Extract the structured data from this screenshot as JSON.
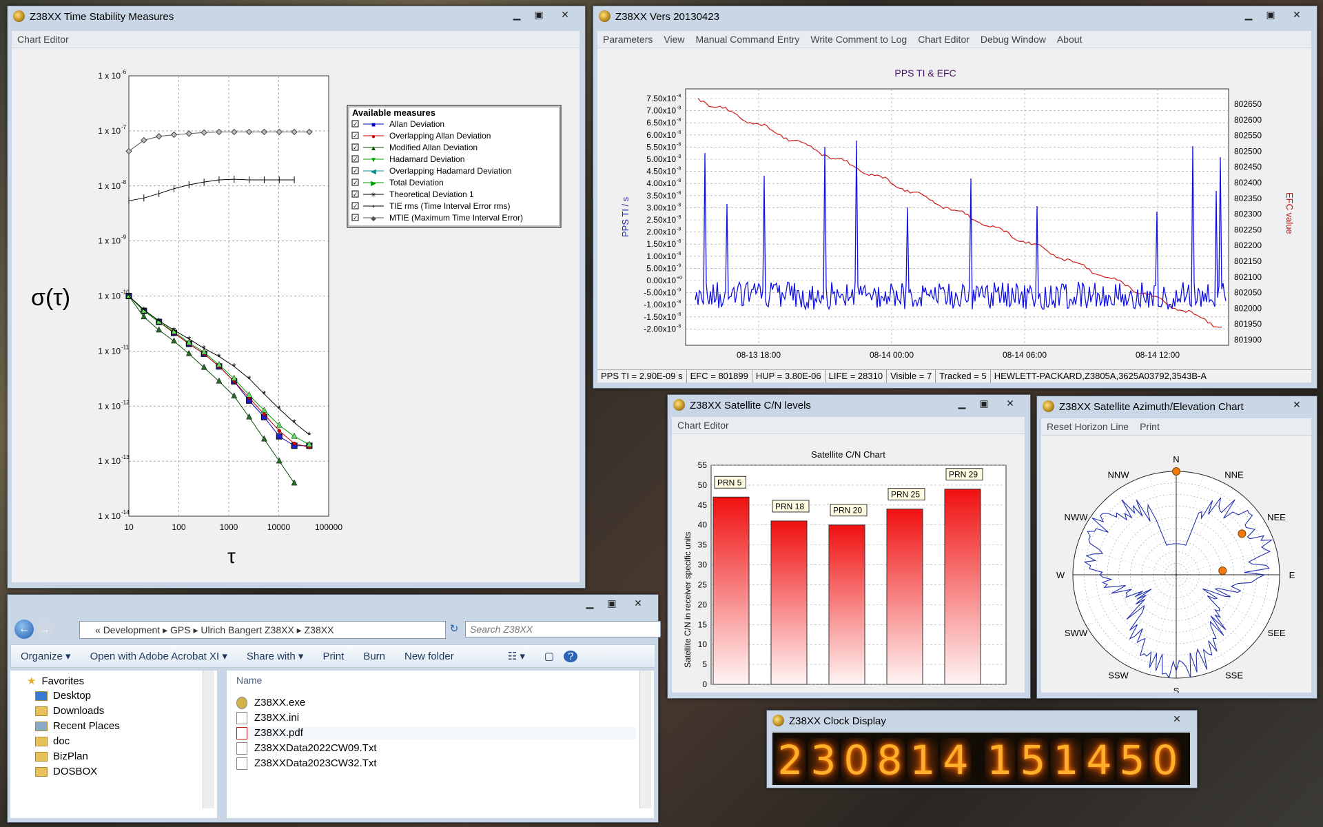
{
  "stability": {
    "title": "Z38XX Time Stability Measures",
    "chart_editor": "Chart Editor",
    "y_label": "σ(τ)",
    "x_label": "τ",
    "yticks": [
      "1 x 10",
      "1 x 10",
      "1 x 10",
      "1 x 10",
      "1 x 10",
      "1 x 10",
      "1 x 10",
      "1 x 10",
      "1 x 10"
    ],
    "yexp": [
      "-6",
      "-7",
      "-8",
      "-9",
      "-10",
      "-11",
      "-12",
      "-13",
      "-14"
    ],
    "xticks": [
      "10",
      "100",
      "1000",
      "10000",
      "100000"
    ],
    "legend_title": "Available measures",
    "legend": [
      "Allan Deviation",
      "Overlapping Allan Deviation",
      "Modified Allan Deviation",
      "Hadamard Deviation",
      "Overlapping Hadamard Deviation",
      "Total Deviation",
      "Theoretical Deviation 1",
      "TIE rms (Time Interval Error rms)",
      "MTIE (Maximum Time Interval Error)"
    ]
  },
  "main": {
    "title": "Z38XX Vers 20130423",
    "menu": [
      "Parameters",
      "View",
      "Manual Command Entry",
      "Write Comment to Log",
      "Chart Editor",
      "Debug Window",
      "About"
    ],
    "chart_title": "PPS TI & EFC",
    "left_label": "PPS TI / s",
    "right_label": "EFC value",
    "left_ticks": [
      "7.50x10",
      "7.00x10",
      "6.50x10",
      "6.00x10",
      "5.50x10",
      "5.00x10",
      "4.50x10",
      "4.00x10",
      "3.50x10",
      "3.00x10",
      "2.50x10",
      "2.00x10",
      "1.50x10",
      "1.00x10",
      "5.00x10",
      "0.00x10",
      "-5.00x10",
      "-1.00x10",
      "-1.50x10",
      "-2.00x10"
    ],
    "left_exp": [
      "-8",
      "-8",
      "-8",
      "-8",
      "-8",
      "-8",
      "-8",
      "-8",
      "-8",
      "-8",
      "-8",
      "-8",
      "-8",
      "-8",
      "-9",
      "+0",
      "-9",
      "-8",
      "-8",
      "-8"
    ],
    "right_ticks": [
      "802650",
      "802600",
      "802550",
      "802500",
      "802450",
      "802400",
      "802350",
      "802300",
      "802250",
      "802200",
      "802150",
      "802100",
      "802050",
      "802000",
      "801950",
      "801900"
    ],
    "x_ticks": [
      "08-13 18:00",
      "08-14 00:00",
      "08-14 06:00",
      "08-14 12:00"
    ],
    "status": [
      "PPS TI = 2.90E-09 s",
      "EFC = 801899",
      "HUP = 3.80E-06",
      "LIFE = 28310",
      "Visible = 7",
      "Tracked = 5",
      "HEWLETT-PACKARD,Z3805A,3625A03792,3543B-A"
    ]
  },
  "explorer": {
    "path": [
      "Development",
      "GPS",
      "Ulrich Bangert Z38XX",
      "Z38XX"
    ],
    "search_placeholder": "Search Z38XX",
    "toolbar": [
      "Organize ▾",
      "Open with Adobe Acrobat XI ▾",
      "Share with ▾",
      "Print",
      "Burn",
      "New folder"
    ],
    "nav": [
      "Favorites",
      "Desktop",
      "Downloads",
      "Recent Places",
      "doc",
      "BizPlan",
      "DOSBOX"
    ],
    "column": "Name",
    "files": [
      "Z38XX.exe",
      "Z38XX.ini",
      "Z38XX.pdf",
      "Z38XXData2022CW09.Txt",
      "Z38XXData2023CW32.Txt"
    ]
  },
  "cn": {
    "title": "Z38XX Satellite C/N levels",
    "chart_editor": "Chart Editor",
    "chart_data": {
      "type": "bar",
      "title": "Satellite C/N Chart",
      "ylabel": "Satellite C/N in receiver specific units",
      "ylim": [
        0,
        55
      ],
      "categories": [
        "PRN 5",
        "PRN 18",
        "PRN 20",
        "PRN 25",
        "PRN 29"
      ],
      "values": [
        47,
        41,
        40,
        44,
        49
      ]
    },
    "yticks": [
      "55",
      "50",
      "45",
      "40",
      "35",
      "30",
      "25",
      "20",
      "15",
      "10",
      "5",
      "0"
    ]
  },
  "az": {
    "title": "Z38XX Satellite Azimuth/Elevation Chart",
    "menu": [
      "Reset Horizon Line",
      "Print"
    ],
    "dirs": [
      "N",
      "NNE",
      "NEE",
      "E",
      "SEE",
      "SSE",
      "S",
      "SSW",
      "SWW",
      "W",
      "NWW",
      "NNW"
    ]
  },
  "clock": {
    "title": "Z38XX Clock Display",
    "digits": [
      "2",
      "3",
      "0",
      "8",
      "1",
      "4",
      "1",
      "5",
      "1",
      "4",
      "5",
      "0"
    ]
  }
}
